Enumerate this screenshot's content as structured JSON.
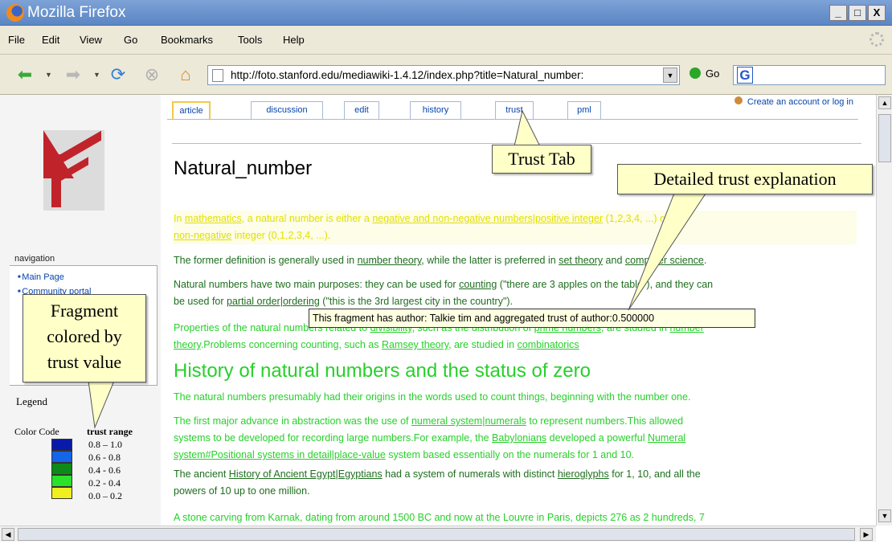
{
  "window": {
    "title": "Mozilla Firefox",
    "min": "_",
    "max": "□",
    "close": "X"
  },
  "menu": [
    "File",
    "Edit",
    "View",
    "Go",
    "Bookmarks",
    "Tools",
    "Help"
  ],
  "toolbar": {
    "url": "http://foto.stanford.edu/mediawiki-1.4.12/index.php?title=Natural_number:",
    "go_label": "Go",
    "search_logo": "G"
  },
  "wiki": {
    "tabs": [
      "article",
      "discussion",
      "edit",
      "history",
      "trust",
      "pml"
    ],
    "account_link": "Create an account or log in",
    "title": "Natural_number",
    "nav_label": "navigation",
    "nav_links": [
      "Main Page",
      "Community portal"
    ],
    "p1_a": "In ",
    "p1_link1": "mathematics",
    "p1_b": ", a natural number is either a ",
    "p1_link2": "negative and non-negative numbers|positive integer",
    "p1_c": " (1,2,3,4, ...) or a",
    "p1_link3": "non-negative",
    "p1_d": " integer (0,1,2,3,4, ...).",
    "p2_a": "The former definition is generally used in ",
    "p2_link1": "number theory",
    "p2_b": ", while the latter is preferred in ",
    "p2_link2": "set theory",
    "p2_c": " and ",
    "p2_link3": "computer science",
    "p2_d": ".",
    "p3_a": "Natural numbers have two main purposes: they can be used for ",
    "p3_link1": "counting",
    "p3_b": " (\"there are 3 apples on the table\"), and they can",
    "p3_c": "be used for ",
    "p3_link2": "partial order|ordering",
    "p3_d": " (\"this is the 3rd largest city in the country\").",
    "p4_a": "Properties of the natural numbers related to ",
    "p4_link1": "divisibility",
    "p4_b": ", such as the distribution of ",
    "p4_link2": "prime numbers",
    "p4_c": ", are studied in ",
    "p4_link3": "number",
    "p4_link3b": "theory",
    "p4_d": ".Problems concerning counting, such as ",
    "p4_link4": "Ramsey theory",
    "p4_e": ", are studied in ",
    "p4_link5": "combinatorics",
    "h2": "History of natural numbers and the status of zero",
    "p5": "The natural numbers presumably had their origins in the words used to count things, beginning with the number one.",
    "p6_a": "The first major advance in abstraction was the use of ",
    "p6_link1": "numeral system|numerals",
    "p6_b": " to represent numbers.This allowed",
    "p6_c": "systems to be developed for recording large numbers.For example, the ",
    "p6_link2": "Babylonians",
    "p6_d": " developed a powerful ",
    "p6_link3": "Numeral",
    "p6_link4": "system#Positional systems in detail|place-value",
    "p6_e": " system based essentially on the numerals for 1 and 10.",
    "p7_a": "The ancient ",
    "p7_link1": "History of Ancient Egypt|Egyptians",
    "p7_b": " had a system of numerals with distinct ",
    "p7_link2": "hieroglyphs",
    "p7_c": " for 1, 10, and all the",
    "p7_d": "powers of 10 up to one million.",
    "p8": "A stone carving from Karnak, dating from around 1500 BC and now at the Louvre in Paris, depicts 276 as 2 hundreds, 7",
    "tooltip": "This fragment has author: Talkie tim and aggregated trust of author:0.500000"
  },
  "legend": {
    "title": "Legend",
    "color_code": "Color Code",
    "trust_range": "trust range",
    "ranges": [
      "0.8 – 1.0",
      "0.6 - 0.8",
      "0.4 - 0.6",
      "0.2 - 0.4",
      "0.0 – 0.2"
    ],
    "colors": [
      "#0a1aa8",
      "#1565e8",
      "#0e8a18",
      "#2ae22a",
      "#f0f020"
    ]
  },
  "callouts": {
    "trust_tab": "Trust Tab",
    "detailed": "Detailed trust explanation",
    "fragment": [
      "Fragment",
      "colored by",
      "trust value"
    ]
  }
}
